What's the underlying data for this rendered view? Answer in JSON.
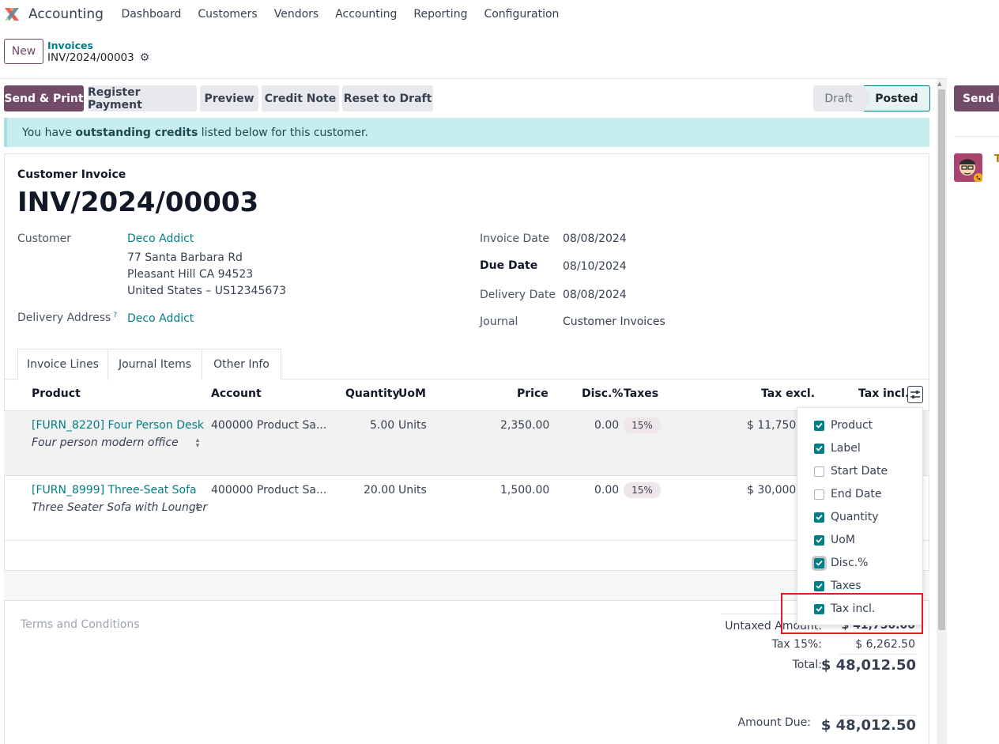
{
  "navbar": {
    "app_name": "Accounting",
    "menus": [
      "Dashboard",
      "Customers",
      "Vendors",
      "Accounting",
      "Reporting",
      "Configuration"
    ]
  },
  "control_panel": {
    "new_label": "New",
    "breadcrumb_parent": "Invoices",
    "breadcrumb_current": "INV/2024/00003"
  },
  "actions": {
    "send_print": "Send & Print",
    "register_payment": "Register Payment",
    "preview": "Preview",
    "credit_note": "Credit Note",
    "reset_to_draft": "Reset to Draft"
  },
  "statusbar": {
    "draft": "Draft",
    "posted": "Posted"
  },
  "alert": {
    "before": "You have ",
    "strong": "outstanding credits",
    "after": " listed below for this customer."
  },
  "invoice": {
    "type": "Customer Invoice",
    "name": "INV/2024/00003",
    "customer_label": "Customer",
    "customer_name": "Deco Addict",
    "address_line1": "77 Santa Barbara Rd",
    "address_line2": "Pleasant Hill CA 94523",
    "address_line3": "United States – US12345673",
    "delivery_address_label": "Delivery Address",
    "delivery_help": "?",
    "delivery_address": "Deco Addict",
    "invoice_date_label": "Invoice Date",
    "invoice_date": "08/08/2024",
    "due_date_label": "Due Date",
    "due_date": "08/10/2024",
    "delivery_date_label": "Delivery Date",
    "delivery_date": "08/08/2024",
    "journal_label": "Journal",
    "journal": "Customer Invoices"
  },
  "tabs": [
    "Invoice Lines",
    "Journal Items",
    "Other Info"
  ],
  "lines": {
    "headers": {
      "product": "Product",
      "account": "Account",
      "quantity": "Quantity",
      "uom": "UoM",
      "price": "Price",
      "disc": "Disc.%",
      "taxes": "Taxes",
      "tax_excl": "Tax excl.",
      "tax_incl": "Tax incl."
    },
    "rows": [
      {
        "product": "[FURN_8220] Four Person Desk",
        "description": "Four person modern office",
        "account": "400000 Product Sa...",
        "quantity": "5.00",
        "uom": "Units",
        "price": "2,350.00",
        "disc": "0.00",
        "tax": "15%",
        "tax_excl": "$ 11,750.00"
      },
      {
        "product": "[FURN_8999] Three-Seat Sofa",
        "description": "Three Seater Sofa with Lounger",
        "account": "400000 Product Sa...",
        "quantity": "20.00",
        "uom": "Units",
        "price": "1,500.00",
        "disc": "0.00",
        "tax": "15%",
        "tax_excl": "$ 30,000.00"
      }
    ]
  },
  "optional_columns": [
    {
      "label": "Product",
      "checked": true
    },
    {
      "label": "Label",
      "checked": true
    },
    {
      "label": "Start Date",
      "checked": false
    },
    {
      "label": "End Date",
      "checked": false
    },
    {
      "label": "Quantity",
      "checked": true
    },
    {
      "label": "UoM",
      "checked": true
    },
    {
      "label": "Disc.%",
      "checked": true
    },
    {
      "label": "Taxes",
      "checked": true
    },
    {
      "label": "Tax incl.",
      "checked": true
    }
  ],
  "totals": {
    "terms_placeholder": "Terms and Conditions",
    "untaxed_label": "Untaxed Amount:",
    "untaxed_value": "$ 41,750.00",
    "tax_label": "Tax 15%:",
    "tax_value": "$ 6,262.50",
    "total_label": "Total:",
    "total_value": "$ 48,012.50",
    "amount_due_label": "Amount Due:",
    "amount_due_value": "$ 48,012.50"
  },
  "chatter": {
    "send_message": "Send message",
    "author_initial": "T"
  },
  "colors": {
    "primary": "#714b67",
    "link": "#017e84",
    "alert_bg": "#c7edef",
    "highlight": "#e01b24"
  }
}
